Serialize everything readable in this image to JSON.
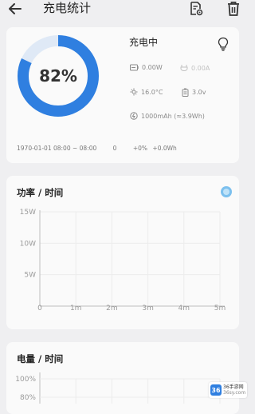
{
  "header": {
    "title": "充电统计",
    "back_icon": "back-arrow-icon",
    "actions": [
      "file-settings-icon",
      "trash-icon"
    ]
  },
  "status_card": {
    "percent_label": "82%",
    "percent_value": 0.82,
    "accent_color": "#2f7fe0",
    "track_color": "#dfe9f6",
    "state_label": "充电中",
    "power": "0.00W",
    "current": "0.00A",
    "temperature": "16.0°C",
    "voltage": "3.0v",
    "capacity": "1000mAh (≈3.9Wh)",
    "footer": {
      "time_range": "1970-01-01  08:00 ~ 08:00",
      "duration": "0",
      "percent_change": "+0%",
      "energy": "+0.0Wh"
    }
  },
  "power_card": {
    "title": "功率 / 时间"
  },
  "battery_card": {
    "title": "电量 / 时间"
  },
  "watermark": {
    "logo": "36",
    "text_line1": "36手游网",
    "text_line2": "36sy.com"
  },
  "chart_data": [
    {
      "type": "line",
      "title": "功率 / 时间",
      "xlabel": "",
      "ylabel": "",
      "x_ticks": [
        "0",
        "1m",
        "2m",
        "3m",
        "4m",
        "5m"
      ],
      "y_ticks": [
        "5W",
        "10W",
        "15W"
      ],
      "xlim": [
        0,
        5
      ],
      "ylim": [
        0,
        15
      ],
      "grid": true,
      "series": []
    },
    {
      "type": "line",
      "title": "电量 / 时间",
      "xlabel": "",
      "ylabel": "",
      "y_ticks": [
        "80%",
        "100%"
      ],
      "grid": true,
      "series": []
    }
  ]
}
